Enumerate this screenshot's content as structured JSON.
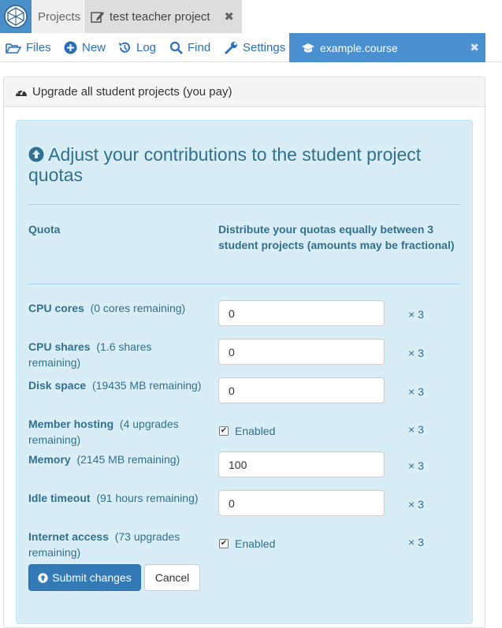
{
  "topbar": {
    "projects_label": "Projects",
    "project_tab_label": "test teacher project",
    "close_glyph": "✖"
  },
  "nav": {
    "files": "Files",
    "new": "New",
    "log": "Log",
    "find": "Find",
    "settings": "Settings",
    "active_file": "example.course",
    "close_glyph": "✖"
  },
  "panel": {
    "heading": "Upgrade all student projects (you pay)"
  },
  "form": {
    "title": "Adjust your contributions to the student project quotas",
    "col_quota": "Quota",
    "col_distribute": "Distribute your quotas equally between 3 student projects (amounts may be fractional)",
    "multiplier": "× 3",
    "rows": [
      {
        "name": "CPU cores",
        "remaining": "(0 cores remaining)",
        "type": "input",
        "value": "0"
      },
      {
        "name": "CPU shares",
        "remaining": "(1.6 shares remaining)",
        "type": "input",
        "value": "0"
      },
      {
        "name": "Disk space",
        "remaining": "(19435 MB remaining)",
        "type": "input",
        "value": "0"
      },
      {
        "name": "Member hosting",
        "remaining": "(4 upgrades remaining)",
        "type": "checkbox",
        "value": "Enabled",
        "checked": true
      },
      {
        "name": "Memory",
        "remaining": "(2145 MB remaining)",
        "type": "input",
        "value": "100"
      },
      {
        "name": "Idle timeout",
        "remaining": "(91 hours remaining)",
        "type": "input",
        "value": "0"
      },
      {
        "name": "Internet access",
        "remaining": "(73 upgrades remaining)",
        "type": "checkbox",
        "value": "Enabled",
        "checked": true
      }
    ],
    "submit_label": "Submit changes",
    "cancel_label": "Cancel"
  },
  "colors": {
    "accent": "#337ab7",
    "active_tab": "#4a8fd0",
    "info_bg": "#d9edf7",
    "info_text": "#31708f"
  }
}
